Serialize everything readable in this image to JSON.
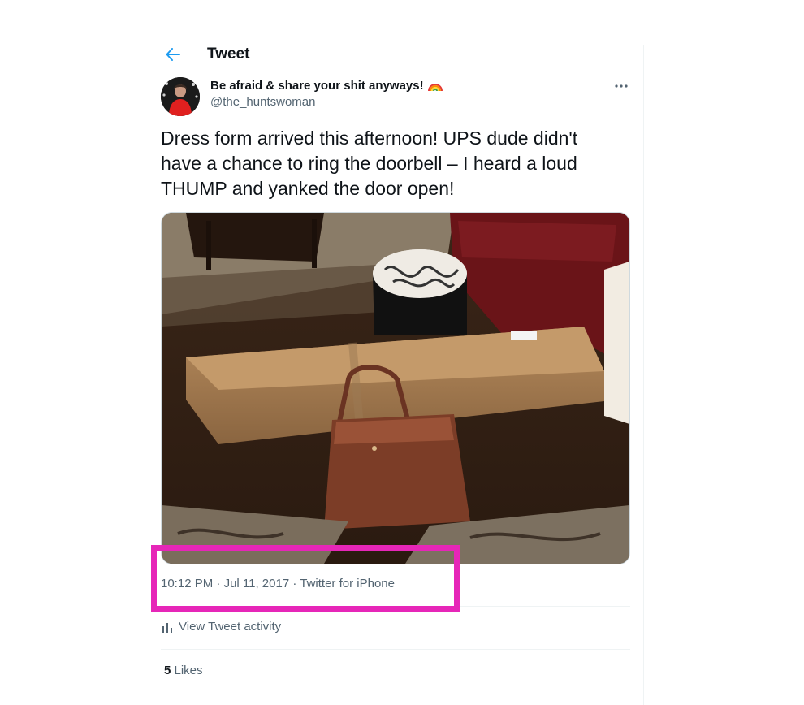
{
  "header": {
    "back_icon": "arrow-left-icon",
    "title": "Tweet"
  },
  "author": {
    "display_name": "Be afraid & share your shit anyways!",
    "emoji_icon": "rainbow-icon",
    "handle": "@the_huntswoman"
  },
  "more_icon": "more-horizontal-icon",
  "tweet": {
    "text": "Dress form arrived this afternoon!  UPS dude didn't\nhave a chance to ring the doorbell – I heard a loud\nTHUMP and yanked the door open!",
    "time": "10:12 PM",
    "sep1": " · ",
    "date": "Jul 11, 2017",
    "sep2": " · ",
    "source": "Twitter for iPhone"
  },
  "activity": {
    "icon": "bar-chart-icon",
    "label": "View Tweet activity"
  },
  "likes": {
    "count": "5",
    "label": " Likes"
  },
  "colors": {
    "accent": "#1d9bf0",
    "text_primary": "#0f1419",
    "text_secondary": "#536471",
    "highlight": "#e626b8"
  }
}
